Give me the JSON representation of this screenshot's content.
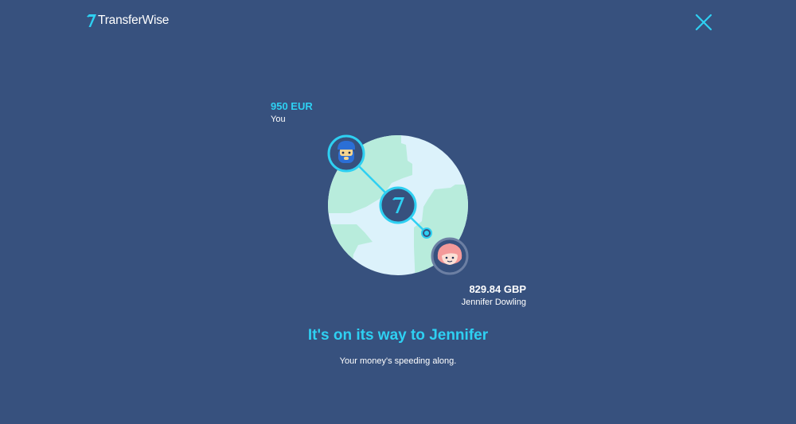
{
  "header": {
    "logo_text": "TransferWise",
    "logo_icon": "transferwise-flag-icon",
    "close_icon": "close-icon"
  },
  "transfer": {
    "sender": {
      "amount": "950 EUR",
      "name": "You",
      "avatar_icon": "male-avatar-icon"
    },
    "recipient": {
      "amount": "829.84 GBP",
      "name": "Jennifer Dowling",
      "avatar_icon": "female-avatar-icon"
    },
    "hub_icon": "transferwise-hub-icon",
    "globe_icon": "globe-icon"
  },
  "status": {
    "headline": "It's on its way to Jennifer",
    "subline": "Your money's speeding along."
  },
  "colors": {
    "background": "#37517e",
    "accent": "#2ed0f2",
    "globe_water": "#dcf2fb",
    "globe_land": "#b8ecdc",
    "hub": "#37517e"
  }
}
